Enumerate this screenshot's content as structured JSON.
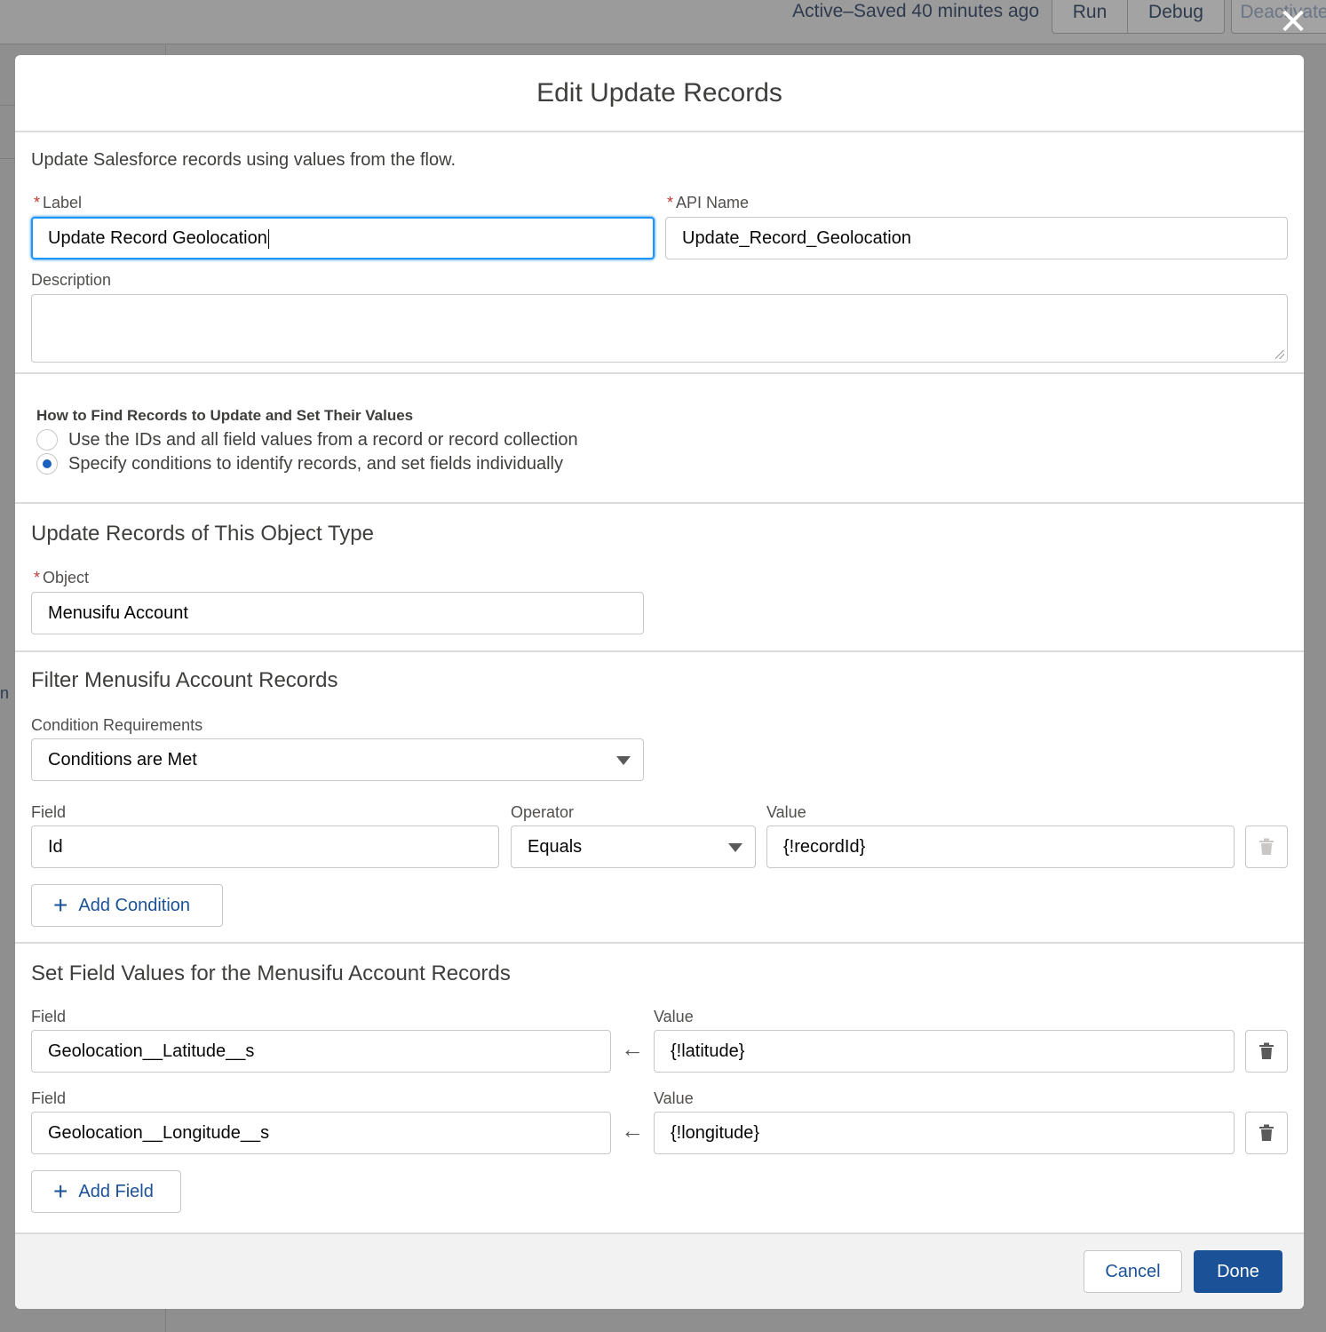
{
  "background": {
    "status": "Active–Saved 40 minutes ago",
    "run_label": "Run",
    "debug_label": "Debug",
    "deactivate_label": "Deactivate",
    "close_icon": "close-icon"
  },
  "modal": {
    "title": "Edit Update Records",
    "intro": "Update Salesforce records using values from the flow.",
    "label_field": {
      "label": "Label",
      "value": "Update Record Geolocation"
    },
    "api_name_field": {
      "label": "API Name",
      "value": "Update_Record_Geolocation"
    },
    "description_field": {
      "label": "Description",
      "value": ""
    },
    "find_records": {
      "title": "How to Find Records to Update and Set Their Values",
      "options": [
        {
          "label": "Use the IDs and all field values from a record or record collection",
          "checked": false
        },
        {
          "label": "Specify conditions to identify records, and set fields individually",
          "checked": true
        }
      ]
    },
    "object_section": {
      "title": "Update Records of This Object Type",
      "object_label": "Object",
      "object_value": "Menusifu Account"
    },
    "filter_section": {
      "title": "Filter Menusifu Account Records",
      "condition_req_label": "Condition Requirements",
      "condition_req_value": "Conditions are Met",
      "field_label": "Field",
      "operator_label": "Operator",
      "value_label": "Value",
      "condition": {
        "field": "Id",
        "operator": "Equals",
        "value": "{!recordId}"
      },
      "add_condition_label": "Add Condition"
    },
    "set_fields_section": {
      "title": "Set Field Values for the Menusifu Account Records",
      "field_label": "Field",
      "value_label": "Value",
      "rows": [
        {
          "field": "Geolocation__Latitude__s",
          "value": "{!latitude}"
        },
        {
          "field": "Geolocation__Longitude__s",
          "value": "{!longitude}"
        }
      ],
      "add_field_label": "Add Field"
    },
    "footer": {
      "cancel_label": "Cancel",
      "done_label": "Done"
    }
  },
  "colors": {
    "brand": "#1b5297",
    "focus": "#1b96ff",
    "required": "#c23934",
    "overlay": "#8f8f8f"
  }
}
